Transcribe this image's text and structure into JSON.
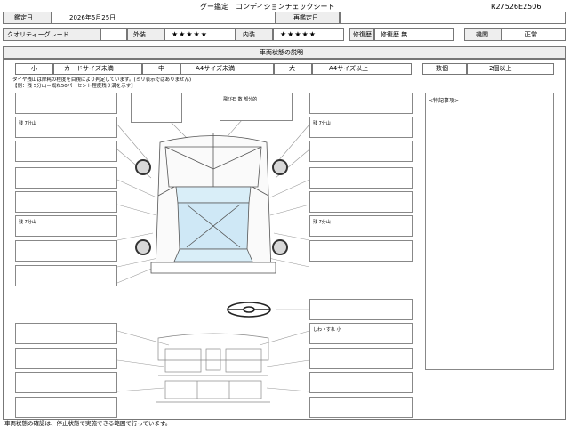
{
  "header": {
    "title": "グー鑑定　コンディションチェックシート",
    "sheet_id": "R27526E2506",
    "appraisal_date_label": "鑑定日",
    "appraisal_date": "2026年5月25日",
    "reappraisal_label": "再鑑定日",
    "reappraisal_value": ""
  },
  "grades": {
    "quality_label": "クオリティーグレード",
    "quality_value": "",
    "exterior_label": "外装",
    "exterior_stars": "★★★★★",
    "interior_label": "内装",
    "interior_stars": "★★★★★",
    "repair_label": "修復歴",
    "repair_value": "修復歴 無",
    "engine_label": "機関",
    "engine_value": "正常"
  },
  "section": {
    "title": "車両状態の説明"
  },
  "legend": {
    "small_label": "小",
    "small_value": "カードサイズ未満",
    "medium_label": "中",
    "medium_value": "A4サイズ未満",
    "large_label": "大",
    "large_value": "A4サイズ以上",
    "count_label": "数個",
    "count_value": "2個以上"
  },
  "notes": {
    "line1": "タイヤ残山は摩耗の程度を目視により判定しています。(ミリ表示ではありません)",
    "line2": "【例：残 5分山＝概ね50パーセント程度残り溝を示す】"
  },
  "callouts": {
    "chip_top": "飛び石 数 部分的",
    "tire_fl": "残 7分山",
    "tire_fr": "残 7分山",
    "tire_rl": "残 7分山",
    "tire_rr": "残 7分山",
    "wrinkle": "しわ・すれ 小"
  },
  "special": {
    "label": "<特記事項>"
  },
  "footer": {
    "note": "車両状態の確認は、停止状態で実施できる範囲で行っています。"
  }
}
